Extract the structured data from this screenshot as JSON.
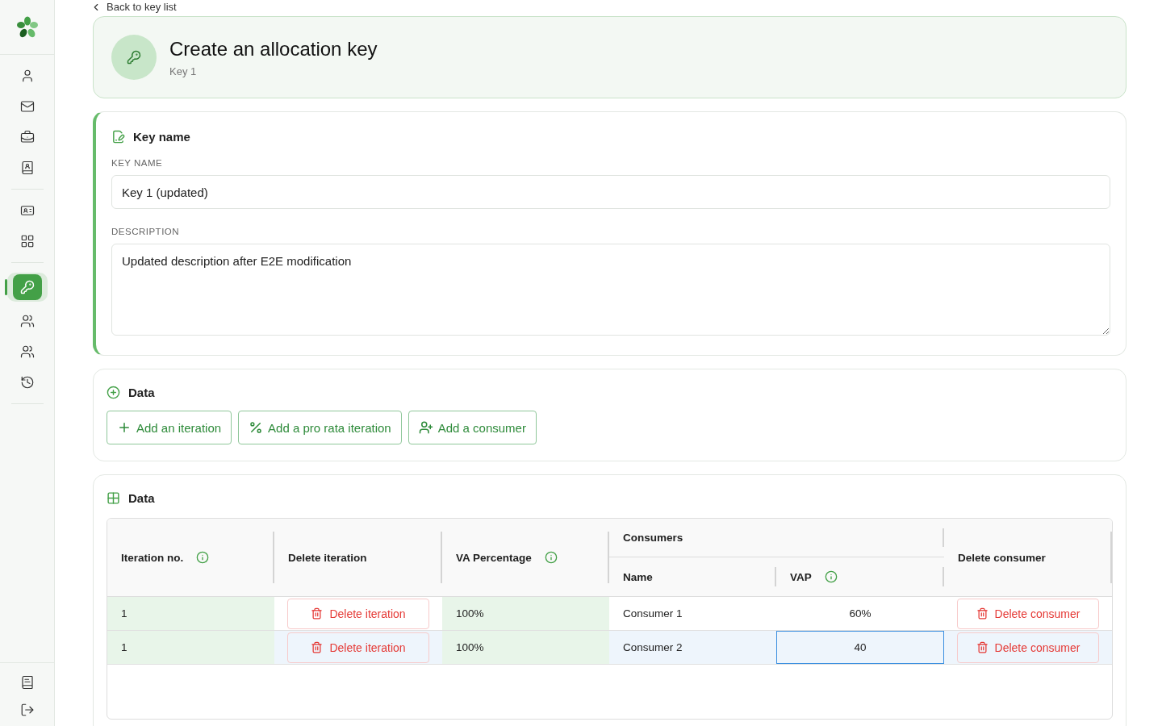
{
  "back_link": "Back to key list",
  "sidebar": {
    "groups": [
      [
        {
          "selected": false
        },
        {
          "selected": false
        },
        {
          "selected": false
        },
        {
          "selected": false
        }
      ],
      [
        {
          "selected": false
        },
        {
          "selected": false
        }
      ],
      [
        {
          "selected": true
        },
        {
          "selected": false
        },
        {
          "selected": false
        },
        {
          "selected": false
        }
      ]
    ],
    "bottom": [
      {
        "selected": false
      },
      {
        "selected": false
      }
    ]
  },
  "header": {
    "title": "Create an allocation key",
    "subtitle": "Key 1"
  },
  "key_section": {
    "title": "Key name",
    "name_label": "KEY NAME",
    "name_value": "Key 1 (updated)",
    "description_label": "DESCRIPTION",
    "description_value": "Updated description after E2E modification"
  },
  "actions_section": {
    "title": "Data",
    "buttons": [
      {
        "kind": "add",
        "label": "Add an iteration"
      },
      {
        "kind": "percent",
        "label": "Add a pro rata iteration"
      },
      {
        "kind": "consumer",
        "label": "Add a consumer"
      }
    ]
  },
  "table_section": {
    "title": "Data",
    "columns": {
      "iteration": "Iteration no.",
      "delete_iteration": "Delete iteration",
      "va_percentage": "VA Percentage",
      "consumers": "Consumers",
      "name": "Name",
      "vap": "VAP",
      "delete_consumer": "Delete consumer"
    },
    "rows": [
      {
        "iteration": "1",
        "delete_iteration": "Delete iteration",
        "va_percentage": "100%",
        "name": "Consumer 1",
        "vap": "60%",
        "delete_consumer": "Delete consumer",
        "selected": false,
        "vap_editing": false
      },
      {
        "iteration": "1",
        "delete_iteration": "Delete iteration",
        "va_percentage": "100%",
        "name": "Consumer 2",
        "vap": "40",
        "delete_consumer": "Delete consumer",
        "selected": true,
        "vap_editing": true
      }
    ]
  }
}
